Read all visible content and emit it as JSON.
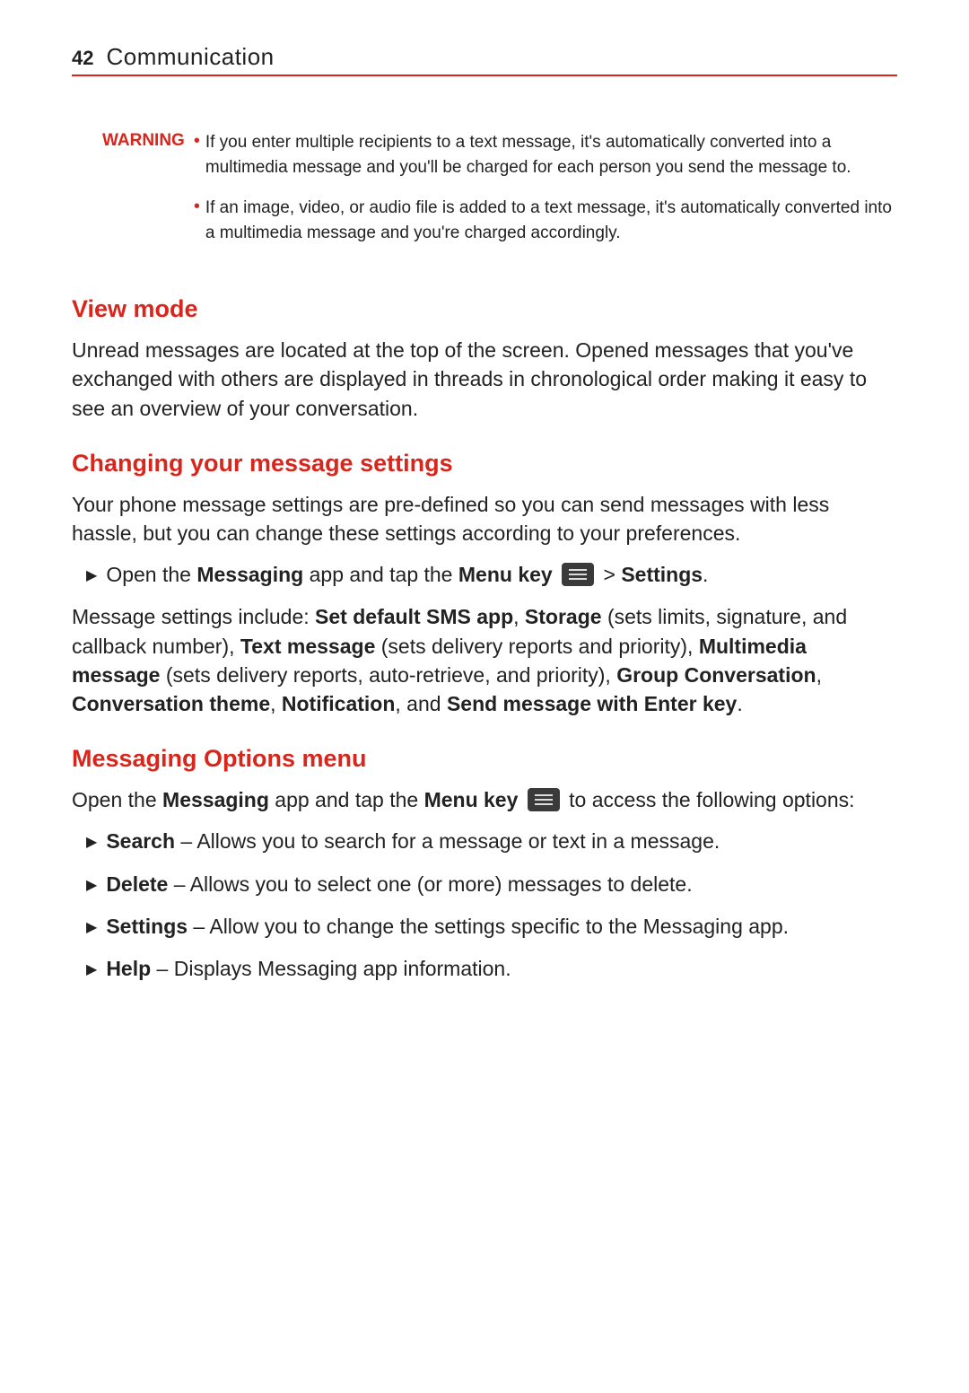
{
  "header": {
    "page_number": "42",
    "title": "Communication"
  },
  "warning": {
    "label": "WARNING",
    "items": [
      "If you enter multiple recipients to a text message, it's automatically converted into a multimedia message and you'll be charged for each person you send the message to.",
      "If an image, video, or audio file is added to a text message, it's automatically converted into a multimedia message and you're charged accordingly."
    ]
  },
  "sections": {
    "view_mode": {
      "heading": "View mode",
      "body": "Unread messages are located at the top of the screen. Opened messages that you've exchanged with others are displayed in threads in chronological order making it easy to see an overview of your conversation."
    },
    "changing": {
      "heading": "Changing your message settings",
      "body": "Your phone message settings are pre-defined so you can send messages with less hassle, but you can change these settings according to your preferences.",
      "step_pre": "Open the ",
      "step_app": "Messaging",
      "step_mid": " app and tap the ",
      "step_menu": "Menu key",
      "step_gt": " > ",
      "step_settings": "Settings",
      "step_end": ".",
      "settings_para": {
        "t0": "Message settings include: ",
        "b1": "Set default SMS app",
        "t1": ", ",
        "b2": "Storage",
        "t2": " (sets limits, signature, and callback number), ",
        "b3": "Text message",
        "t3": " (sets delivery reports and priority), ",
        "b4": "Multimedia message",
        "t4": " (sets delivery reports, auto-retrieve, and priority), ",
        "b5": "Group Conversation",
        "t5": ", ",
        "b6": "Conversation theme",
        "t6": ", ",
        "b7": "Notification",
        "t7": ", and ",
        "b8": "Send message with Enter key",
        "t8": "."
      }
    },
    "options": {
      "heading": "Messaging Options menu",
      "intro_pre": "Open the ",
      "intro_app": "Messaging",
      "intro_mid": " app and tap the ",
      "intro_menu": "Menu key",
      "intro_post": " to access the following options:",
      "items": [
        {
          "name": "Search",
          "desc": " – Allows you to search for a message or text in a message."
        },
        {
          "name": "Delete",
          "desc": " – Allows you to select one (or more) messages to delete."
        },
        {
          "name": "Settings",
          "desc": " – Allow you to change the settings specific to the Messaging app."
        },
        {
          "name": "Help",
          "desc": " – Displays Messaging app information."
        }
      ]
    }
  }
}
